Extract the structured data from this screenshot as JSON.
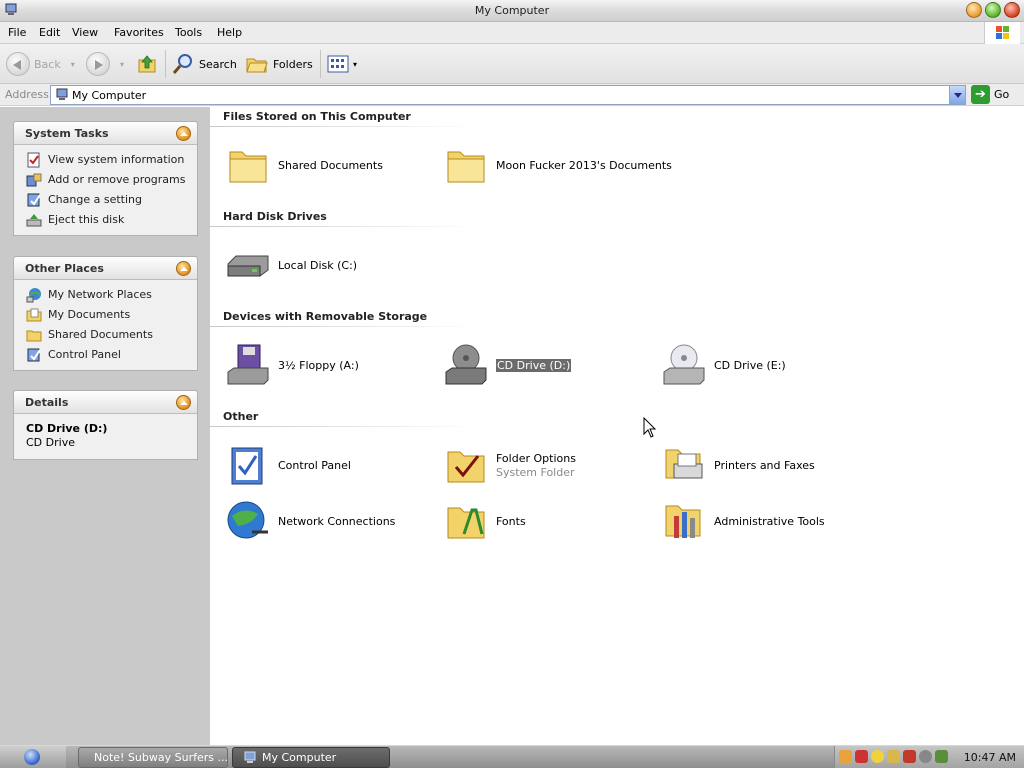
{
  "window": {
    "title": "My Computer"
  },
  "menu": [
    "File",
    "Edit",
    "View",
    "Favorites",
    "Tools",
    "Help"
  ],
  "toolbar": {
    "back": "Back",
    "search": "Search",
    "folders": "Folders"
  },
  "address": {
    "label": "Address",
    "value": "My Computer",
    "go": "Go"
  },
  "left_panels": {
    "system_tasks": {
      "title": "System Tasks",
      "items": [
        "View system information",
        "Add or remove programs",
        "Change a setting",
        "Eject this disk"
      ]
    },
    "other_places": {
      "title": "Other Places",
      "items": [
        "My Network Places",
        "My Documents",
        "Shared Documents",
        "Control Panel"
      ]
    },
    "details": {
      "title": "Details",
      "name": "CD Drive (D:)",
      "type": "CD Drive"
    }
  },
  "groups": {
    "stored": {
      "title": "Files Stored on This Computer",
      "items": [
        "Shared Documents",
        "Moon Fucker 2013's Documents"
      ]
    },
    "hdd": {
      "title": "Hard Disk Drives",
      "items": [
        "Local Disk (C:)"
      ]
    },
    "removable": {
      "title": "Devices with Removable Storage",
      "items": [
        "3½ Floppy (A:)",
        "CD Drive (D:)",
        "CD Drive (E:)"
      ]
    },
    "other": {
      "title": "Other",
      "items": [
        "Control Panel",
        "Folder Options",
        "Printers and Faxes",
        "Network Connections",
        "Fonts",
        "Administrative Tools"
      ],
      "folder_options_sub": "System Folder"
    }
  },
  "taskbar": {
    "buttons": [
      "Note! Subway Surfers ...",
      "My Computer"
    ],
    "clock": "10:47 AM"
  },
  "colors": {
    "selection": "#6b6b6b",
    "panel_bg": "#c9c9c9",
    "go_green": "#2f9c32"
  }
}
